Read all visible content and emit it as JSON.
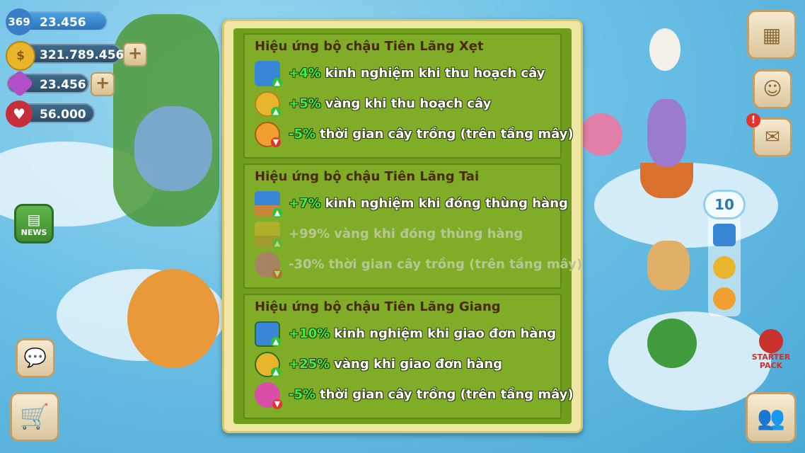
{
  "hud": {
    "level": "369",
    "xp": "23.456",
    "gold": "321.789.456",
    "gems": "23.456",
    "hearts": "56.000"
  },
  "left_buttons": {
    "news_label": "NEWS"
  },
  "right_panel": {
    "buff_count": "10",
    "starter_pack_label": "STARTER PACK"
  },
  "dialog": {
    "sections": [
      {
        "title": "Hiệu ứng bộ chậu Tiên Lãng Xẹt",
        "effects": [
          {
            "value": "+4%",
            "text": "kinh nghiệm khi thu hoạch cây",
            "icon": "xp-icon",
            "direction": "up",
            "active": true
          },
          {
            "value": "+5%",
            "text": "vàng khi thu hoạch cây",
            "icon": "coin-icon",
            "direction": "up",
            "active": true
          },
          {
            "value": "-5%",
            "text": "thời gian cây trồng (trên tầng mây)",
            "icon": "clock-icon",
            "direction": "down",
            "active": true
          }
        ]
      },
      {
        "title": "Hiệu ứng bộ chậu Tiên Lãng Tai",
        "effects": [
          {
            "value": "+7%",
            "text": "kinh nghiệm khi đóng thùng hàng",
            "icon": "xp-crate-icon",
            "direction": "up",
            "active": true
          },
          {
            "value": "+99%",
            "text": "vàng khi đóng thùng hàng",
            "icon": "coin-crate-icon",
            "direction": "up",
            "active": false
          },
          {
            "value": "-30%",
            "text": "thời gian cây trồng (trên tầng mây)",
            "icon": "plant-clock-icon",
            "direction": "down",
            "active": false
          }
        ]
      },
      {
        "title": "Hiệu ứng bộ chậu Tiên Lãng Giang",
        "effects": [
          {
            "value": "+10%",
            "text": "kinh nghiệm khi giao đơn hàng",
            "icon": "xp-order-icon",
            "direction": "up",
            "active": true
          },
          {
            "value": "+25%",
            "text": "vàng khi giao đơn hàng",
            "icon": "coin-order-icon",
            "direction": "up",
            "active": true
          },
          {
            "value": "-5%",
            "text": "thời gian cây trồng (trên tầng mây)",
            "icon": "plant-clock-icon",
            "direction": "down",
            "active": true
          }
        ]
      }
    ]
  },
  "colors": {
    "panel_border": "#f1e7a4",
    "panel_green": "#6f9d1c",
    "section_green": "#7fad27",
    "title_brown": "#4a2a08",
    "value_green": "#3df046"
  }
}
